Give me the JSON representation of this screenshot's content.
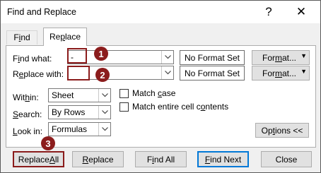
{
  "window": {
    "title": "Find and Replace",
    "help_icon": "question-icon",
    "close_icon": "close-icon"
  },
  "tabs": [
    {
      "label_u": "i",
      "label_pre": "F",
      "label_post": "nd",
      "active": false
    },
    {
      "label_pre": "Re",
      "label_u": "p",
      "label_post": "lace",
      "active": true
    }
  ],
  "find": {
    "label_pre": "F",
    "label_u": "i",
    "label_post": "nd what:",
    "value": "-",
    "format_text": "No Format Set",
    "format_button": {
      "pre": "For",
      "u": "m",
      "post": "at..."
    }
  },
  "replace": {
    "label_pre": "R",
    "label_u": "e",
    "label_post": "place with:",
    "value": "",
    "format_text": "No Format Set",
    "format_button": {
      "pre": "For",
      "u": "m",
      "post": "at..."
    }
  },
  "within": {
    "label_pre": "Wit",
    "label_u": "h",
    "label_post": "in:",
    "value": "Sheet"
  },
  "search": {
    "label_pre": "",
    "label_u": "S",
    "label_post": "earch:",
    "value": "By Rows"
  },
  "look_in": {
    "label_pre": "",
    "label_u": "L",
    "label_post": "ook in:",
    "value": "Formulas"
  },
  "options": {
    "match_case": {
      "pre": "Match ",
      "u": "c",
      "post": "ase",
      "checked": false
    },
    "match_entire": {
      "pre": "Match entire cell c",
      "u": "o",
      "post": "ntents",
      "checked": false
    },
    "options_button": {
      "pre": "Op",
      "u": "t",
      "post": "ions <<"
    }
  },
  "buttons": {
    "replace_all": {
      "pre": "Replace ",
      "u": "A",
      "post": "ll"
    },
    "replace": {
      "pre": "",
      "u": "R",
      "post": "eplace"
    },
    "find_all": {
      "pre": "F",
      "u": "i",
      "post": "nd All"
    },
    "find_next": {
      "pre": "",
      "u": "F",
      "post": "ind Next"
    },
    "close": "Close"
  },
  "callouts": [
    "1",
    "2",
    "3"
  ],
  "colors": {
    "callout": "#8b1c1c",
    "focus": "#0078d7"
  }
}
